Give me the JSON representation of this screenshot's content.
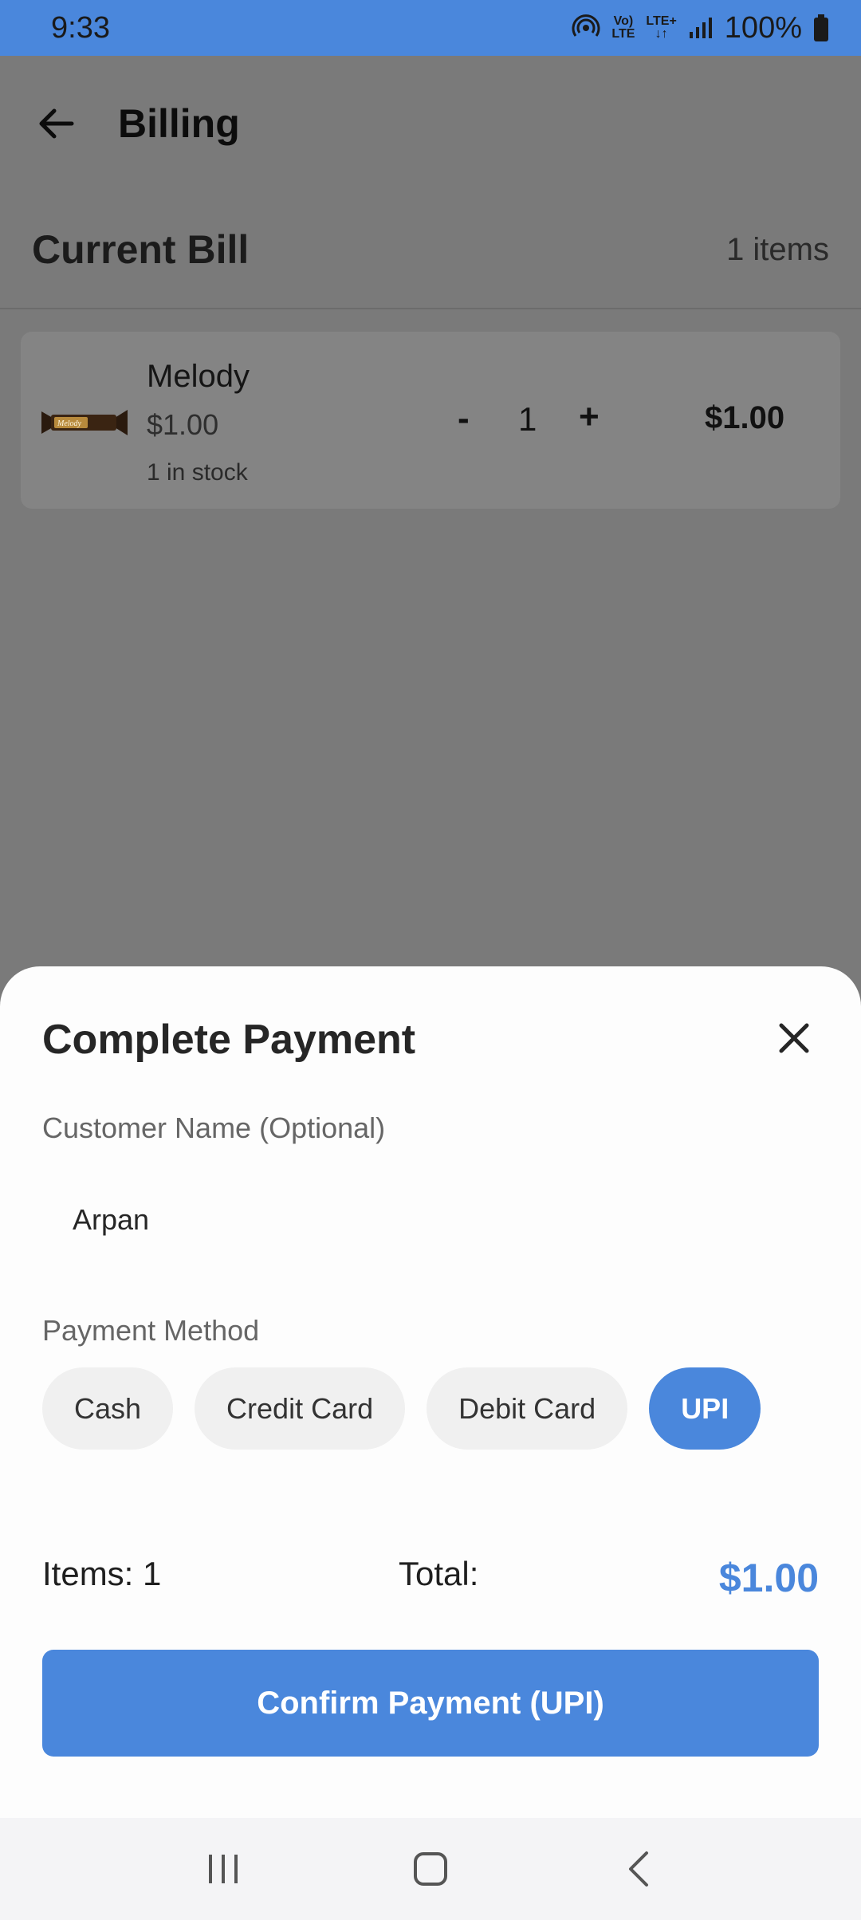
{
  "status": {
    "time": "9:33",
    "volte_top": "Vo)",
    "volte_bottom": "LTE",
    "lte_top": "LTE+",
    "lte_bottom": "↓↑",
    "battery": "100%"
  },
  "header": {
    "title": "Billing"
  },
  "bill": {
    "title": "Current Bill",
    "count": "1 items",
    "items": [
      {
        "name": "Melody",
        "price": "$1.00",
        "stock": "1 in stock",
        "minus": "-",
        "qty": "1",
        "plus": "+",
        "total": "$1.00"
      }
    ]
  },
  "sheet": {
    "title": "Complete Payment",
    "customer_label": "Customer Name (Optional)",
    "customer_value": "Arpan",
    "payment_label": "Payment Method",
    "methods": [
      "Cash",
      "Credit Card",
      "Debit Card",
      "UPI"
    ],
    "selected_method": "UPI",
    "items_text": "Items: 1",
    "total_label": "Total:",
    "total_value": "$1.00",
    "confirm_label": "Confirm Payment (UPI)"
  },
  "colors": {
    "accent": "#4a87dc",
    "scrim": "#7a7a7a",
    "sheet": "#fdfdfd"
  }
}
